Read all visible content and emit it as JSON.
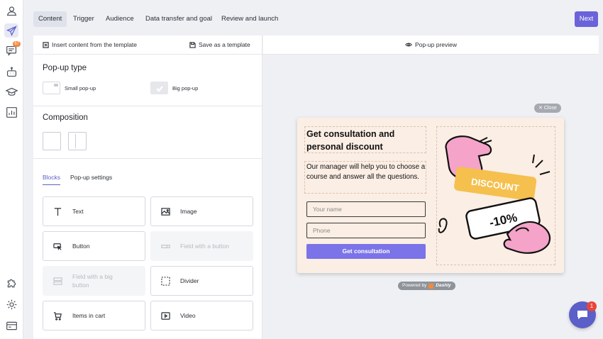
{
  "sidebar": {
    "items": [
      {
        "icon": "user-icon"
      },
      {
        "icon": "paper-plane-icon",
        "active": true
      },
      {
        "icon": "chat-icon",
        "badge": "67"
      },
      {
        "icon": "robot-icon"
      },
      {
        "icon": "graduation-cap-icon"
      },
      {
        "icon": "analytics-icon"
      },
      {
        "icon": "puzzle-icon"
      },
      {
        "icon": "gear-icon"
      },
      {
        "icon": "billing-icon"
      }
    ]
  },
  "header": {
    "tabs": [
      "Content",
      "Trigger",
      "Audience",
      "Data transfer and goal",
      "Review and launch"
    ],
    "active_tab": "Content",
    "next_label": "Next"
  },
  "editor": {
    "insert_template": "Insert content from the template",
    "save_template": "Save as a template",
    "popup_type": {
      "title": "Pop-up type",
      "small": "Small pop-up",
      "big": "Big pop-up"
    },
    "composition": {
      "title": "Composition"
    },
    "subtabs": {
      "blocks": "Blocks",
      "settings": "Pop-up settings"
    },
    "blocks": {
      "text": "Text",
      "image": "Image",
      "button": "Button",
      "field_button": "Field with a button",
      "field_big_1": "Field with a big",
      "field_big_2": "button",
      "divider": "Divider",
      "items_cart": "Items in cart",
      "video": "Video"
    }
  },
  "preview": {
    "header": "Pop-up preview",
    "close": "Close",
    "popup": {
      "title": "Get consultation and personal discount",
      "text": "Our manager will help you to choose a course and answer all the questions.",
      "name_placeholder": "Your name",
      "phone_placeholder": "Phone",
      "button": "Get consultation",
      "discount": "DISCOUNT",
      "percent": "-10%"
    },
    "powered_by": "Powered by",
    "brand": "Dashly"
  },
  "chat": {
    "badge": "1"
  },
  "colors": {
    "accent": "#6b63d9",
    "popup_bg": "#fbeee4",
    "popup_button": "#7b73e8",
    "discount_yellow": "#f5c04e",
    "hand_pink": "#f5a3c8"
  }
}
